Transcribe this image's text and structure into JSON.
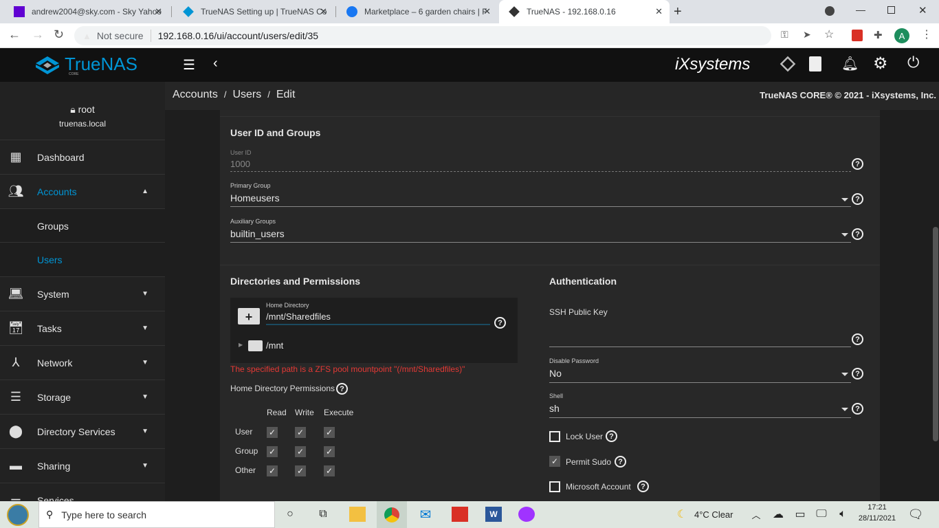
{
  "browser": {
    "tabs": [
      {
        "title": "andrew2004@sky.com - Sky Yahoo",
        "icon": "mail-icon",
        "color": "#6001d2"
      },
      {
        "title": "TrueNAS Setting up | TrueNAS Co",
        "icon": "truenas-icon",
        "color": "#0095d5"
      },
      {
        "title": "Marketplace – 6 garden chairs | F",
        "icon": "facebook-icon",
        "color": "#1877f2"
      },
      {
        "title": "TrueNAS - 192.168.0.16",
        "icon": "truenas-icon",
        "color": "#333"
      }
    ],
    "security": "Not secure",
    "url": "192.168.0.16/ui/account/users/edit/35",
    "avatar": "A"
  },
  "app": {
    "logo": "TrueNAS",
    "logo_sub": "CORE",
    "vendor": "iXsystems"
  },
  "sidebar": {
    "user": "root",
    "host": "truenas.local",
    "items": [
      {
        "label": "Dashboard"
      },
      {
        "label": "Accounts"
      },
      {
        "label": "Groups"
      },
      {
        "label": "Users"
      },
      {
        "label": "System"
      },
      {
        "label": "Tasks"
      },
      {
        "label": "Network"
      },
      {
        "label": "Storage"
      },
      {
        "label": "Directory Services"
      },
      {
        "label": "Sharing"
      },
      {
        "label": "Services"
      }
    ]
  },
  "breadcrumb": [
    "Accounts",
    "Users",
    "Edit"
  ],
  "copyright": "TrueNAS CORE® © 2021 - iXsystems, Inc.",
  "form": {
    "section1": "User ID and Groups",
    "user_id_label": "User ID",
    "user_id": "1000",
    "primary_group_label": "Primary Group",
    "primary_group": "Homeusers",
    "aux_groups_label": "Auxiliary Groups",
    "aux_groups": "builtin_users",
    "section2": "Directories and Permissions",
    "home_dir_label": "Home Directory",
    "home_dir": "/mnt/Sharedfiles",
    "tree_node": "/mnt",
    "error": "The specified path is a ZFS pool mountpoint \"(/mnt/Sharedfiles)\"",
    "perm_label": "Home Directory Permissions",
    "perm_cols": [
      "Read",
      "Write",
      "Execute"
    ],
    "perm_rows": [
      "User",
      "Group",
      "Other"
    ],
    "section3": "Authentication",
    "ssh_label": "SSH Public Key",
    "disable_pw_label": "Disable Password",
    "disable_pw": "No",
    "shell_label": "Shell",
    "shell": "sh",
    "lock_user": "Lock User",
    "permit_sudo": "Permit Sudo",
    "microsoft_account": "Microsoft Account"
  },
  "taskbar": {
    "search": "Type here to search",
    "weather": "4°C  Clear",
    "time": "17:21",
    "date": "28/11/2021"
  }
}
